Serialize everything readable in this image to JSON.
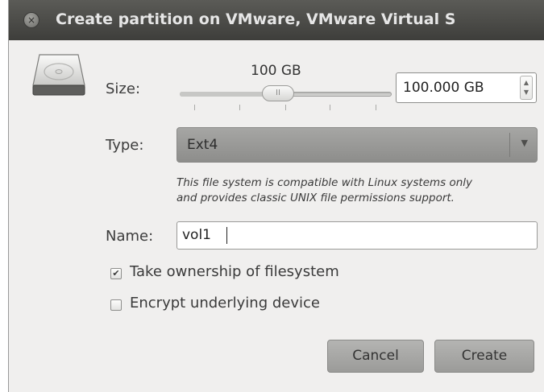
{
  "window": {
    "title": "Create partition on VMware, VMware Virtual S",
    "close_glyph": "×"
  },
  "form": {
    "size_label": "Size:",
    "size_slider_text": "100 GB",
    "size_slider_level": 0.5,
    "size_spin_value": "100.000 GB",
    "type_label": "Type:",
    "type_value": "Ext4",
    "type_description_line1": "This file system is compatible with Linux systems only",
    "type_description_line2": "and provides classic UNIX file permissions support.",
    "name_label": "Name:",
    "name_value": "vol1",
    "take_ownership_label": "Take ownership of filesystem",
    "take_ownership_checked": true,
    "encrypt_label": "Encrypt underlying device",
    "encrypt_checked": false
  },
  "buttons": {
    "cancel": "Cancel",
    "create": "Create"
  },
  "icons": {
    "disk": "hard-disk-icon",
    "close": "close-icon",
    "spin_up": "▲",
    "spin_down": "▼",
    "combo_arrow": "▼",
    "check": "✔"
  },
  "colors": {
    "titlebar": "#4a4a47",
    "dialog_bg": "#f0efee",
    "combo_bg": "#9a9a98",
    "button_bg": "#a8a8a6"
  }
}
